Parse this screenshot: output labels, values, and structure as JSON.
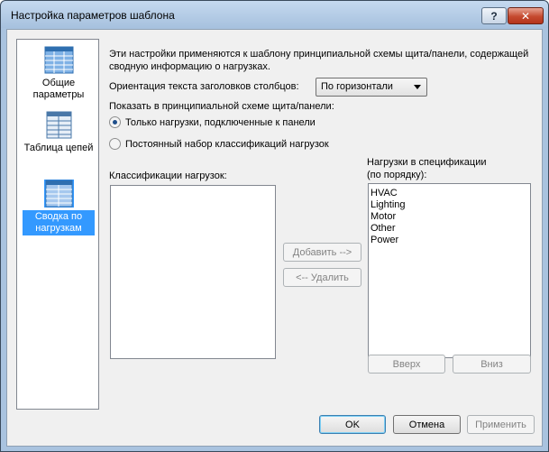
{
  "window": {
    "title": "Настройка параметров шаблона",
    "help_label": "?",
    "close_label": "✕"
  },
  "nav": {
    "items": [
      {
        "label": "Общие параметры",
        "icon": "grid-icon"
      },
      {
        "label": "Таблица цепей",
        "icon": "table-icon"
      },
      {
        "label": "Сводка по нагрузкам",
        "icon": "summary-icon",
        "selected": true
      }
    ]
  },
  "main": {
    "description": "Эти настройки применяются к шаблону принципиальной схемы щита/панели, содержащей сводную информацию о нагрузках.",
    "orientation_label": "Ориентация текста заголовков столбцов:",
    "orientation_value": "По горизонтали",
    "show_label": "Показать в принципиальной схеме щита/панели:",
    "radio_options": [
      {
        "label": "Только нагрузки, подключенные к панели",
        "checked": true
      },
      {
        "label": "Постоянный набор классификаций нагрузок",
        "checked": false
      }
    ],
    "classifications_label": "Классификации нагрузок:",
    "spec_label_line1": "Нагрузки в спецификации",
    "spec_label_line2": "(по порядку):",
    "spec_items": [
      "HVAC",
      "Lighting",
      "Motor",
      "Other",
      "Power"
    ],
    "add_label": "Добавить -->",
    "remove_label": "<-- Удалить",
    "up_label": "Вверх",
    "down_label": "Вниз"
  },
  "footer": {
    "ok_label": "OK",
    "cancel_label": "Отмена",
    "apply_label": "Применить"
  },
  "colors": {
    "selection": "#3399ff",
    "frame": "#a9c3df"
  }
}
